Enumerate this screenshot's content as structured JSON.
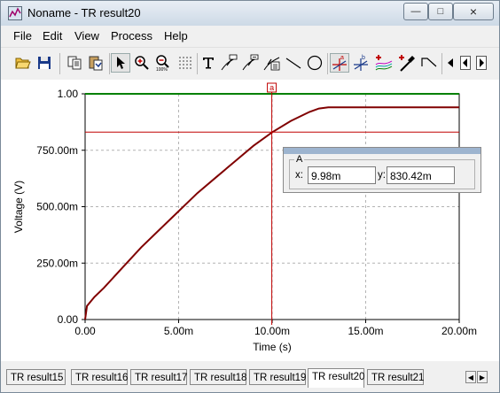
{
  "window": {
    "title": "Noname - TR result20",
    "controls": {
      "minimize": "—",
      "maximize": "□",
      "close": "×"
    }
  },
  "menu": [
    "File",
    "Edit",
    "View",
    "Process",
    "Help"
  ],
  "toolbar": [
    {
      "name": "open-icon"
    },
    {
      "name": "save-icon"
    },
    {
      "name": "copy-icon"
    },
    {
      "name": "paste-special-icon"
    },
    {
      "name": "pointer-icon"
    },
    {
      "name": "zoom-in-icon"
    },
    {
      "name": "zoom-out-icon"
    },
    {
      "name": "grid-icon"
    },
    {
      "name": "text-icon"
    },
    {
      "name": "curve-label-icon"
    },
    {
      "name": "curve-label-2-icon"
    },
    {
      "name": "curve-label-3-icon"
    },
    {
      "name": "line-icon"
    },
    {
      "name": "circle-icon"
    },
    {
      "name": "cursor-a-icon"
    },
    {
      "name": "cursor-b-icon"
    },
    {
      "name": "add-curve-icon"
    },
    {
      "name": "probe-icon"
    },
    {
      "name": "step-icon"
    },
    {
      "name": "scroll-left-icon"
    },
    {
      "name": "scroll-prev-icon"
    },
    {
      "name": "scroll-right-icon"
    }
  ],
  "chart_data": {
    "type": "line",
    "xlabel": "Time (s)",
    "ylabel": "Voltage (V)",
    "xlim": [
      0,
      0.02
    ],
    "ylim": [
      0,
      1.0
    ],
    "x_ticks": [
      "0.00",
      "5.00m",
      "10.00m",
      "15.00m",
      "20.00m"
    ],
    "y_ticks": [
      "0.00",
      "250.00m",
      "500.00m",
      "750.00m",
      "1.00"
    ],
    "grid": true,
    "series": [
      {
        "color": "#008000",
        "x": [
          0,
          0.02
        ],
        "y": [
          1.0,
          1.0
        ]
      },
      {
        "color": "#800000",
        "x": [
          0,
          0.0001,
          0.0005,
          0.001,
          0.002,
          0.003,
          0.004,
          0.005,
          0.006,
          0.007,
          0.008,
          0.009,
          0.01,
          0.011,
          0.012,
          0.0125,
          0.013,
          0.014,
          0.015,
          0.02
        ],
        "y": [
          0,
          0.06,
          0.1,
          0.14,
          0.23,
          0.32,
          0.4,
          0.48,
          0.56,
          0.63,
          0.7,
          0.77,
          0.83,
          0.88,
          0.92,
          0.935,
          0.94,
          0.94,
          0.94,
          0.94
        ]
      }
    ],
    "cursor": {
      "label": "a",
      "x": 0.00998,
      "y": 0.83042,
      "color": "#c00000"
    }
  },
  "cursor_panel": {
    "group_label": "A",
    "x_label": "x:",
    "x_value": "9.98m",
    "y_label": "y:",
    "y_value": "830.42m"
  },
  "tabs": [
    "TR result15",
    "TR result16",
    "TR result17",
    "TR result18",
    "TR result19",
    "TR result20",
    "TR result21"
  ],
  "active_tab": 5
}
